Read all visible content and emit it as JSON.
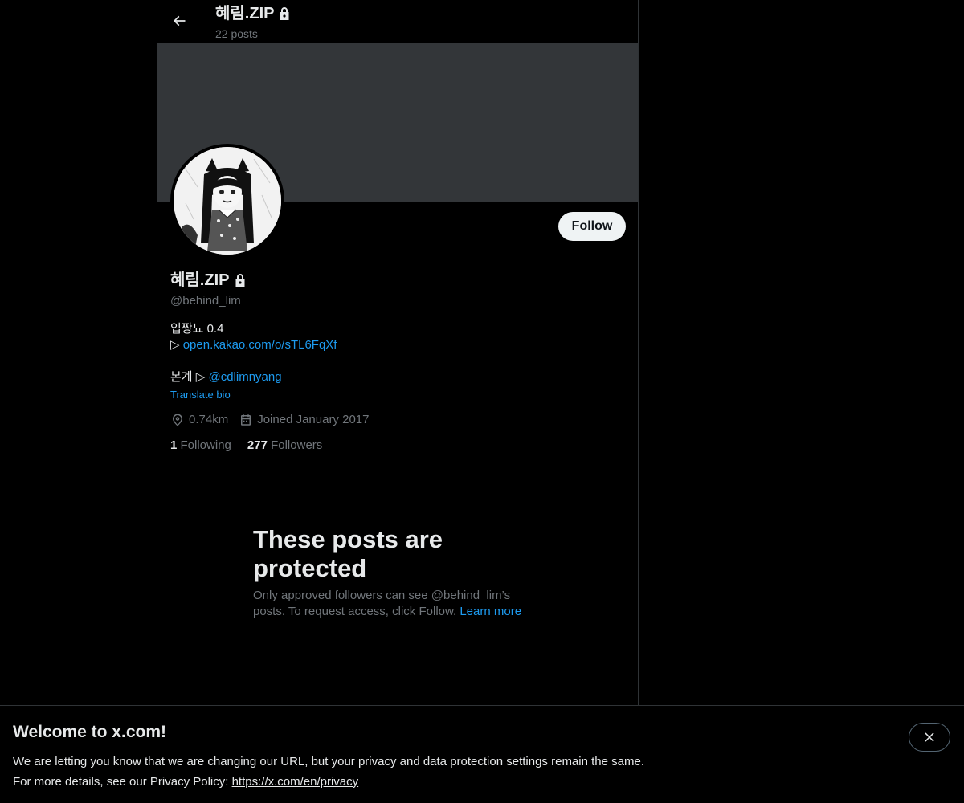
{
  "header": {
    "name": "혜림.ZIP",
    "posts_count": "22 posts"
  },
  "profile": {
    "name": "혜림.ZIP",
    "handle": "@behind_lim",
    "follow_label": "Follow",
    "bio_line1": "입짱뇨 0.4",
    "bio_line2_prefix": "▷ ",
    "bio_line2_link": "open.kakao.com/o/sTL6FqXf",
    "bio_line3_prefix": "본계 ▷ ",
    "bio_line3_link": "@cdlimnyang",
    "translate_label": "Translate bio",
    "location": "0.74km",
    "joined": "Joined January 2017",
    "following_count": "1",
    "following_label": "Following",
    "followers_count": "277",
    "followers_label": "Followers"
  },
  "protected": {
    "title": "These posts are protected",
    "text": "Only approved followers can see @behind_lim’s posts. To request access, click Follow.",
    "learn_more": "Learn more"
  },
  "cookie_bar": {
    "title": "Welcome to x.com!",
    "line1": "We are letting you know that we are changing our URL, but your privacy and data protection settings remain the same.",
    "line2_prefix": "For more details, see our Privacy Policy: ",
    "privacy_link": "https://x.com/en/privacy"
  },
  "colors": {
    "accent": "#1d9bf0",
    "muted": "#71767b",
    "banner": "#333639"
  },
  "icons": [
    "back-arrow-icon",
    "lock-icon",
    "location-icon",
    "calendar-icon",
    "close-icon"
  ]
}
